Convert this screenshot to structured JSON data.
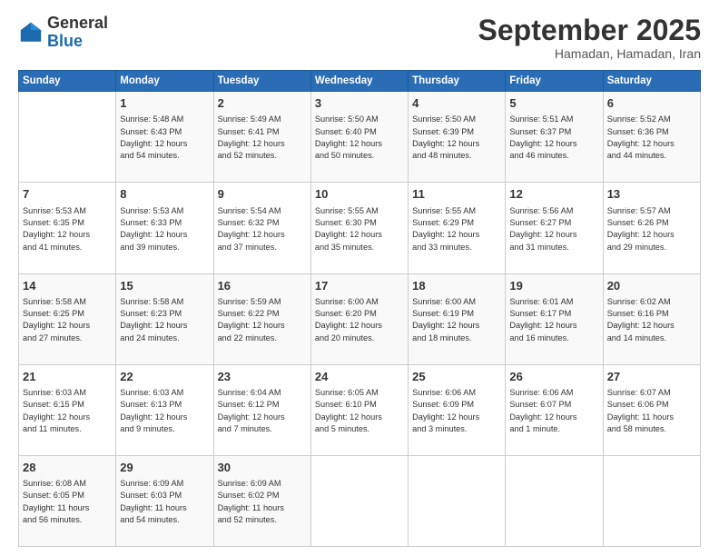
{
  "logo": {
    "general": "General",
    "blue": "Blue"
  },
  "header": {
    "month_title": "September 2025",
    "subtitle": "Hamadan, Hamadan, Iran"
  },
  "weekdays": [
    "Sunday",
    "Monday",
    "Tuesday",
    "Wednesday",
    "Thursday",
    "Friday",
    "Saturday"
  ],
  "weeks": [
    [
      {
        "day": "",
        "content": ""
      },
      {
        "day": "1",
        "content": "Sunrise: 5:48 AM\nSunset: 6:43 PM\nDaylight: 12 hours\nand 54 minutes."
      },
      {
        "day": "2",
        "content": "Sunrise: 5:49 AM\nSunset: 6:41 PM\nDaylight: 12 hours\nand 52 minutes."
      },
      {
        "day": "3",
        "content": "Sunrise: 5:50 AM\nSunset: 6:40 PM\nDaylight: 12 hours\nand 50 minutes."
      },
      {
        "day": "4",
        "content": "Sunrise: 5:50 AM\nSunset: 6:39 PM\nDaylight: 12 hours\nand 48 minutes."
      },
      {
        "day": "5",
        "content": "Sunrise: 5:51 AM\nSunset: 6:37 PM\nDaylight: 12 hours\nand 46 minutes."
      },
      {
        "day": "6",
        "content": "Sunrise: 5:52 AM\nSunset: 6:36 PM\nDaylight: 12 hours\nand 44 minutes."
      }
    ],
    [
      {
        "day": "7",
        "content": "Sunrise: 5:53 AM\nSunset: 6:35 PM\nDaylight: 12 hours\nand 41 minutes."
      },
      {
        "day": "8",
        "content": "Sunrise: 5:53 AM\nSunset: 6:33 PM\nDaylight: 12 hours\nand 39 minutes."
      },
      {
        "day": "9",
        "content": "Sunrise: 5:54 AM\nSunset: 6:32 PM\nDaylight: 12 hours\nand 37 minutes."
      },
      {
        "day": "10",
        "content": "Sunrise: 5:55 AM\nSunset: 6:30 PM\nDaylight: 12 hours\nand 35 minutes."
      },
      {
        "day": "11",
        "content": "Sunrise: 5:55 AM\nSunset: 6:29 PM\nDaylight: 12 hours\nand 33 minutes."
      },
      {
        "day": "12",
        "content": "Sunrise: 5:56 AM\nSunset: 6:27 PM\nDaylight: 12 hours\nand 31 minutes."
      },
      {
        "day": "13",
        "content": "Sunrise: 5:57 AM\nSunset: 6:26 PM\nDaylight: 12 hours\nand 29 minutes."
      }
    ],
    [
      {
        "day": "14",
        "content": "Sunrise: 5:58 AM\nSunset: 6:25 PM\nDaylight: 12 hours\nand 27 minutes."
      },
      {
        "day": "15",
        "content": "Sunrise: 5:58 AM\nSunset: 6:23 PM\nDaylight: 12 hours\nand 24 minutes."
      },
      {
        "day": "16",
        "content": "Sunrise: 5:59 AM\nSunset: 6:22 PM\nDaylight: 12 hours\nand 22 minutes."
      },
      {
        "day": "17",
        "content": "Sunrise: 6:00 AM\nSunset: 6:20 PM\nDaylight: 12 hours\nand 20 minutes."
      },
      {
        "day": "18",
        "content": "Sunrise: 6:00 AM\nSunset: 6:19 PM\nDaylight: 12 hours\nand 18 minutes."
      },
      {
        "day": "19",
        "content": "Sunrise: 6:01 AM\nSunset: 6:17 PM\nDaylight: 12 hours\nand 16 minutes."
      },
      {
        "day": "20",
        "content": "Sunrise: 6:02 AM\nSunset: 6:16 PM\nDaylight: 12 hours\nand 14 minutes."
      }
    ],
    [
      {
        "day": "21",
        "content": "Sunrise: 6:03 AM\nSunset: 6:15 PM\nDaylight: 12 hours\nand 11 minutes."
      },
      {
        "day": "22",
        "content": "Sunrise: 6:03 AM\nSunset: 6:13 PM\nDaylight: 12 hours\nand 9 minutes."
      },
      {
        "day": "23",
        "content": "Sunrise: 6:04 AM\nSunset: 6:12 PM\nDaylight: 12 hours\nand 7 minutes."
      },
      {
        "day": "24",
        "content": "Sunrise: 6:05 AM\nSunset: 6:10 PM\nDaylight: 12 hours\nand 5 minutes."
      },
      {
        "day": "25",
        "content": "Sunrise: 6:06 AM\nSunset: 6:09 PM\nDaylight: 12 hours\nand 3 minutes."
      },
      {
        "day": "26",
        "content": "Sunrise: 6:06 AM\nSunset: 6:07 PM\nDaylight: 12 hours\nand 1 minute."
      },
      {
        "day": "27",
        "content": "Sunrise: 6:07 AM\nSunset: 6:06 PM\nDaylight: 11 hours\nand 58 minutes."
      }
    ],
    [
      {
        "day": "28",
        "content": "Sunrise: 6:08 AM\nSunset: 6:05 PM\nDaylight: 11 hours\nand 56 minutes."
      },
      {
        "day": "29",
        "content": "Sunrise: 6:09 AM\nSunset: 6:03 PM\nDaylight: 11 hours\nand 54 minutes."
      },
      {
        "day": "30",
        "content": "Sunrise: 6:09 AM\nSunset: 6:02 PM\nDaylight: 11 hours\nand 52 minutes."
      },
      {
        "day": "",
        "content": ""
      },
      {
        "day": "",
        "content": ""
      },
      {
        "day": "",
        "content": ""
      },
      {
        "day": "",
        "content": ""
      }
    ]
  ]
}
